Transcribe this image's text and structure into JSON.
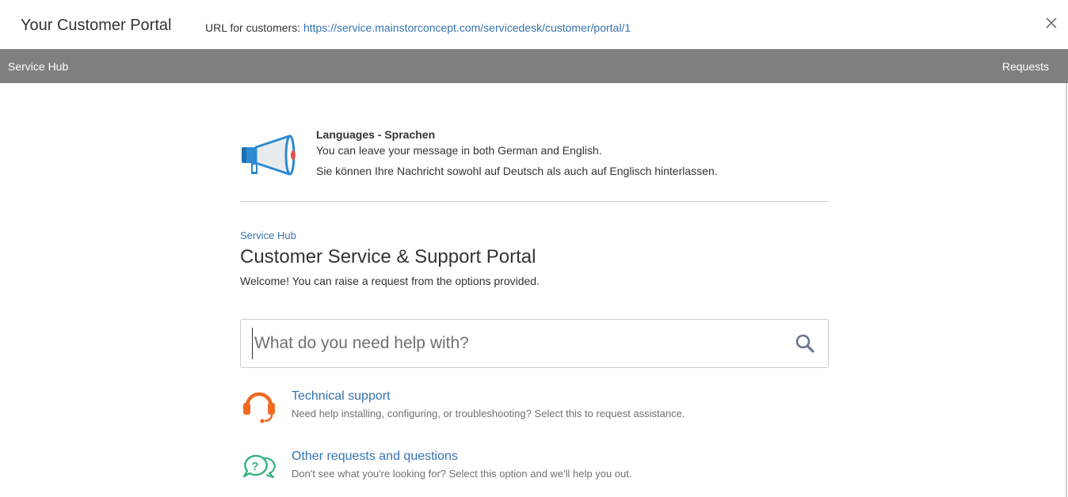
{
  "header": {
    "title": "Your Customer Portal",
    "url_label": "URL for customers:",
    "url": "https://service.mainstorconcept.com/servicedesk/customer/portal/1",
    "close_icon": "close-icon"
  },
  "nav": {
    "left_label": "Service Hub",
    "right_label": "Requests",
    "background": "#7f7f7f"
  },
  "announcement": {
    "icon": "megaphone-icon",
    "title": "Languages - Sprachen",
    "line1": "You can leave your message in both German and English.",
    "line2": "Sie können Ihre Nachricht sowohl auf Deutsch als auch auf Englisch hinterlassen."
  },
  "portal": {
    "breadcrumb": "Service Hub",
    "title": "Customer Service & Support Portal",
    "welcome": "Welcome! You can raise a request from the options provided."
  },
  "search": {
    "placeholder": "What do you need help with?",
    "value": "",
    "icon": "search-icon"
  },
  "request_types": [
    {
      "icon": "headset-icon",
      "icon_color": "#f06a22",
      "name": "Technical support",
      "description": "Need help installing, configuring, or troubleshooting? Select this to request assistance."
    },
    {
      "icon": "question-bubbles-icon",
      "icon_color": "#36b37e",
      "name": "Other requests and questions",
      "description": "Don't see what you're looking for? Select this option and we'll help you out."
    }
  ],
  "colors": {
    "link": "#3572b0",
    "text": "#333333",
    "muted": "#707070"
  }
}
